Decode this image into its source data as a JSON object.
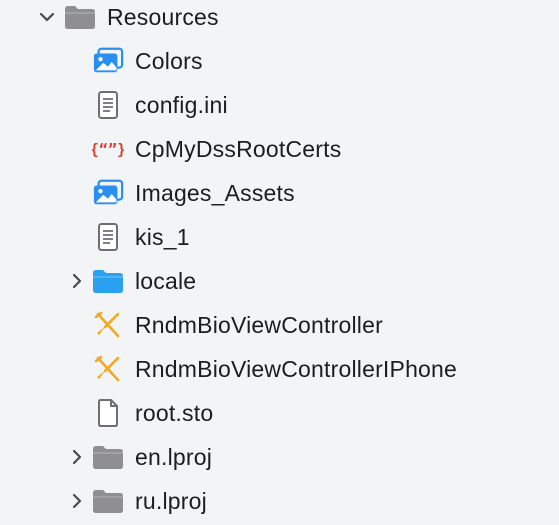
{
  "navigator": {
    "items": [
      {
        "label": "Resources",
        "icon": "folder-gray-icon",
        "disclosure": "expanded",
        "depth": 0
      },
      {
        "label": "Colors",
        "icon": "asset-catalog-icon",
        "disclosure": "none",
        "depth": 1
      },
      {
        "label": "config.ini",
        "icon": "text-file-icon",
        "disclosure": "none",
        "depth": 1
      },
      {
        "label": "CpMyDssRootCerts",
        "icon": "json-file-icon",
        "disclosure": "none",
        "depth": 1
      },
      {
        "label": "Images_Assets",
        "icon": "asset-catalog-icon",
        "disclosure": "none",
        "depth": 1
      },
      {
        "label": "kis_1",
        "icon": "text-file-icon",
        "disclosure": "none",
        "depth": 1
      },
      {
        "label": "locale",
        "icon": "folder-blue-icon",
        "disclosure": "collapsed",
        "depth": 1
      },
      {
        "label": "RndmBioViewController",
        "icon": "xib-file-icon",
        "disclosure": "none",
        "depth": 1
      },
      {
        "label": "RndmBioViewControllerIPhone",
        "icon": "xib-file-icon",
        "disclosure": "none",
        "depth": 1
      },
      {
        "label": "root.sto",
        "icon": "plain-file-icon",
        "disclosure": "none",
        "depth": 1
      },
      {
        "label": "en.lproj",
        "icon": "folder-gray-icon",
        "disclosure": "collapsed",
        "depth": 1
      },
      {
        "label": "ru.lproj",
        "icon": "folder-gray-icon",
        "disclosure": "collapsed",
        "depth": 1
      }
    ]
  },
  "colors": {
    "background": "#f3f4f6",
    "text": "#1d1d1f",
    "folder_gray": "#8e8e93",
    "folder_blue": "#2aa1ef",
    "asset_blue": "#2b8ff0",
    "json_red": "#d9412e",
    "xib_orange": "#f6a623",
    "file_gray": "#6e6e73"
  }
}
